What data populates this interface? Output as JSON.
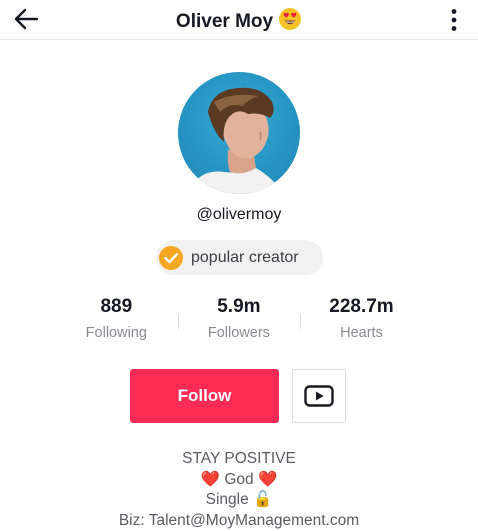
{
  "header": {
    "title": "Oliver Moy",
    "title_emoji": "heart-eyes-emoji",
    "back_icon": "arrow-left-icon",
    "more_icon": "more-vertical-icon"
  },
  "profile": {
    "username": "@olivermoy",
    "badge": {
      "label": "popular creator",
      "icon": "verified-check-icon"
    }
  },
  "stats": [
    {
      "value": "889",
      "label": "Following"
    },
    {
      "value": "5.9m",
      "label": "Followers"
    },
    {
      "value": "228.7m",
      "label": "Hearts"
    }
  ],
  "actions": {
    "follow_label": "Follow",
    "youtube_icon": "youtube-icon"
  },
  "bio": {
    "line1": "STAY POSITIVE",
    "line2": "God",
    "line2_heart": "❤️",
    "line3": "Single",
    "line3_emoji": "🔓",
    "line4": "Biz: Talent@MoyManagement.com"
  },
  "colors": {
    "accent": "#fe2c55",
    "badge_check": "#f5a623",
    "text_primary": "#161823",
    "text_secondary": "#8a8b91"
  }
}
